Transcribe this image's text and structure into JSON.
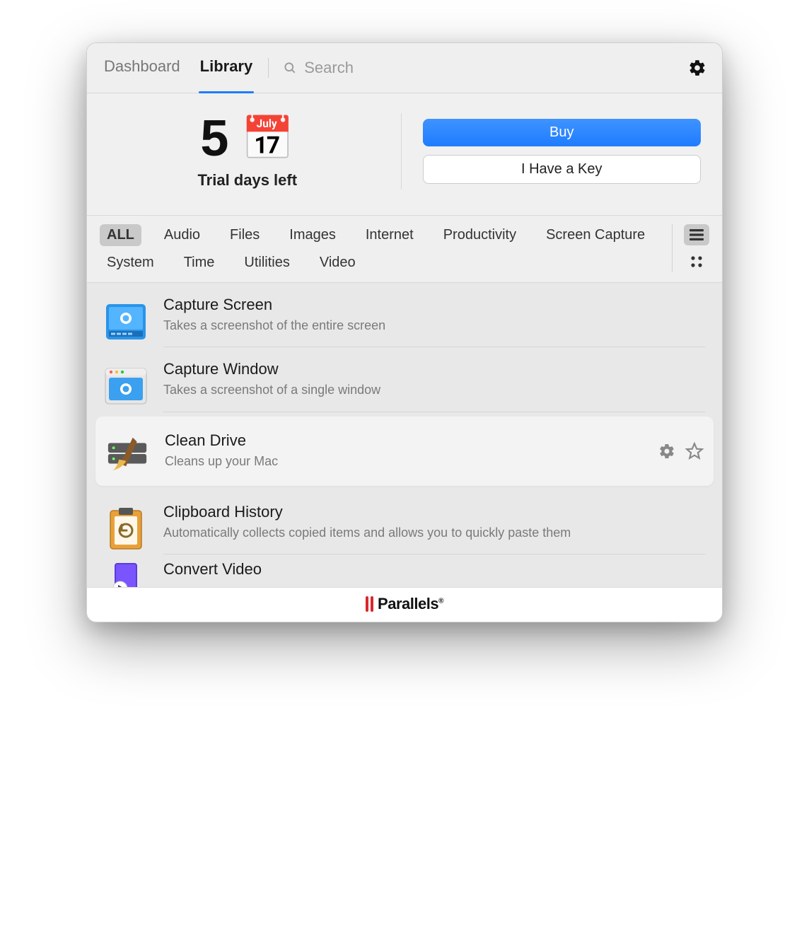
{
  "header": {
    "tabs": [
      {
        "label": "Dashboard",
        "active": false
      },
      {
        "label": "Library",
        "active": true
      }
    ],
    "search_placeholder": "Search"
  },
  "trial": {
    "days": "5",
    "subtitle": "Trial days left",
    "buy_label": "Buy",
    "key_label": "I Have a Key"
  },
  "filters": {
    "chips": [
      "ALL",
      "Audio",
      "Files",
      "Images",
      "Internet",
      "Productivity",
      "Screen Capture",
      "System",
      "Time",
      "Utilities",
      "Video"
    ],
    "active_index": 0
  },
  "items": [
    {
      "title": "Capture Screen",
      "desc": "Takes a screenshot of the entire screen",
      "icon": "capture-screen"
    },
    {
      "title": "Capture Window",
      "desc": "Takes a screenshot of a single window",
      "icon": "capture-window"
    },
    {
      "title": "Clean Drive",
      "desc": "Cleans up your Mac",
      "icon": "clean-drive",
      "hovered": true
    },
    {
      "title": "Clipboard History",
      "desc": "Automatically collects copied items and allows you to quickly paste them",
      "icon": "clipboard-history"
    },
    {
      "title": "Convert Video",
      "desc": "",
      "icon": "convert-video",
      "last": true
    }
  ],
  "footer": {
    "brand": "Parallels"
  }
}
